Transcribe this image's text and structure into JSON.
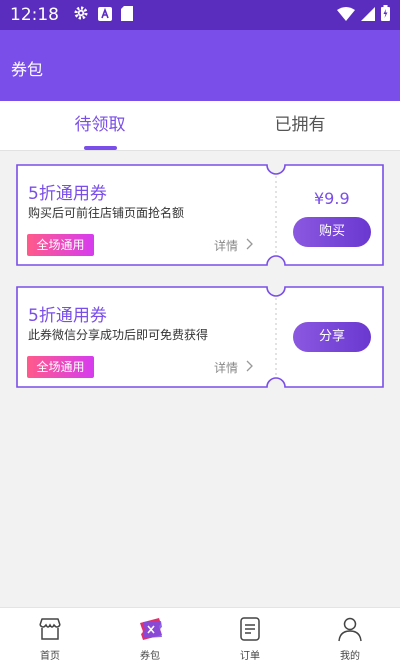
{
  "status_bar": {
    "time": "12:18"
  },
  "app_bar": {
    "title": "券包"
  },
  "tabs": [
    {
      "label": "待领取",
      "active": true
    },
    {
      "label": "已拥有",
      "active": false
    }
  ],
  "coupons": [
    {
      "title": "5折通用券",
      "description": "购买后可前往店铺页面抢名额",
      "badge": "全场通用",
      "detail_label": "详情",
      "price": "¥9.9",
      "button_label": "购买"
    },
    {
      "title": "5折通用券",
      "description": "此券微信分享成功后即可免费获得",
      "badge": "全场通用",
      "detail_label": "详情",
      "button_label": "分享"
    }
  ],
  "bottom_nav": [
    {
      "label": "首页",
      "icon": "home-shop-icon",
      "active": false
    },
    {
      "label": "券包",
      "icon": "coupon-ticket-icon",
      "active": true
    },
    {
      "label": "订单",
      "icon": "order-list-icon",
      "active": false
    },
    {
      "label": "我的",
      "icon": "user-profile-icon",
      "active": false
    }
  ],
  "colors": {
    "status_bar": "#5a2dbf",
    "primary": "#7a4ee8",
    "badge_gradient_start": "#ff5a8a",
    "badge_gradient_end": "#d63cf0"
  }
}
